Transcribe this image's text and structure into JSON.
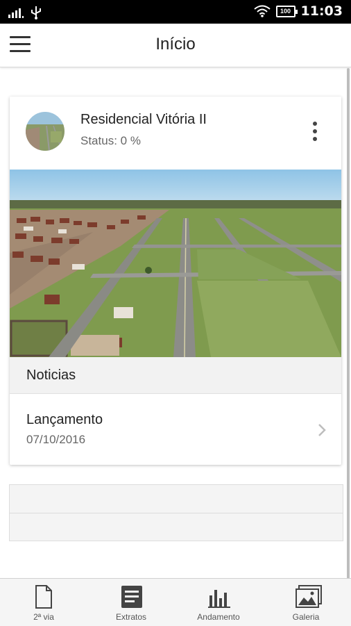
{
  "status_bar": {
    "time": "11:03",
    "battery": "100",
    "icons": [
      "signal-icon",
      "usb-icon",
      "wifi-icon",
      "battery-icon"
    ]
  },
  "app_bar": {
    "title": "Início",
    "menu_icon": "hamburger-menu-icon"
  },
  "project_card": {
    "name": "Residencial Vitória II",
    "status": "Status: 0 %",
    "more_icon": "more-vert-icon",
    "news_section": {
      "header": "Noticias",
      "items": [
        {
          "title": "Lançamento",
          "date": "07/10/2016"
        }
      ]
    }
  },
  "bottom_nav": {
    "items": [
      {
        "label": "2ª via",
        "icon": "document-icon"
      },
      {
        "label": "Extratos",
        "icon": "statement-icon"
      },
      {
        "label": "Andamento",
        "icon": "bar-chart-icon"
      },
      {
        "label": "Galeria",
        "icon": "gallery-icon"
      }
    ]
  },
  "colors": {
    "status_bar_bg": "#000000",
    "app_bar_bg": "#ffffff",
    "section_header_bg": "#f2f2f2",
    "bottom_nav_bg": "#f5f5f5"
  }
}
